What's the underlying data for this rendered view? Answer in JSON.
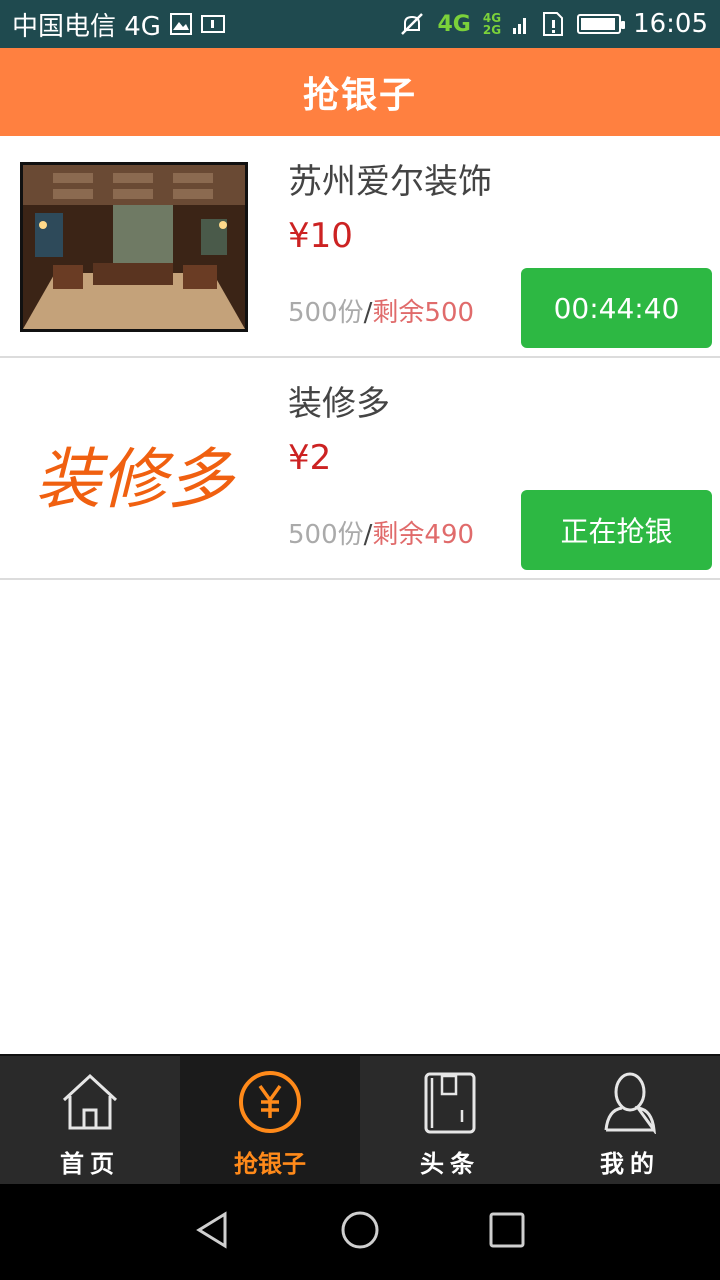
{
  "status_bar": {
    "carrier": "中国电信 4G",
    "network_4g": "4G",
    "network_stack_top": "4G",
    "network_stack_bottom": "2G",
    "time": "16:05",
    "battery_level": 0.95,
    "icons": [
      "image-icon",
      "sim-icon",
      "mute-icon",
      "signal-icon",
      "sd-card-alert-icon",
      "battery-icon"
    ]
  },
  "header": {
    "title": "抢银子"
  },
  "items": [
    {
      "name": "苏州爱尔装饰",
      "price": "¥10",
      "total": "500份",
      "separator": "/",
      "remaining": "剩余500",
      "button_label": "00:44:40"
    },
    {
      "name": "装修多",
      "price": "¥2",
      "total": "500份",
      "separator": "/",
      "remaining": "剩余490",
      "button_label": "正在抢银",
      "logo_text": "装修多"
    }
  ],
  "bottom_nav": [
    {
      "label": "首页",
      "icon": "home-icon",
      "active": false
    },
    {
      "label": "抢银子",
      "icon": "yen-icon",
      "active": true
    },
    {
      "label": "头条",
      "icon": "book-icon",
      "active": false
    },
    {
      "label": "我的",
      "icon": "person-icon",
      "active": false
    }
  ],
  "system_nav": [
    "back-icon",
    "home-circle-icon",
    "recents-icon"
  ],
  "colors": {
    "accent": "#ff8040",
    "button": "#2db843",
    "price": "#cc2222",
    "active_tab": "#ff8a1a"
  }
}
